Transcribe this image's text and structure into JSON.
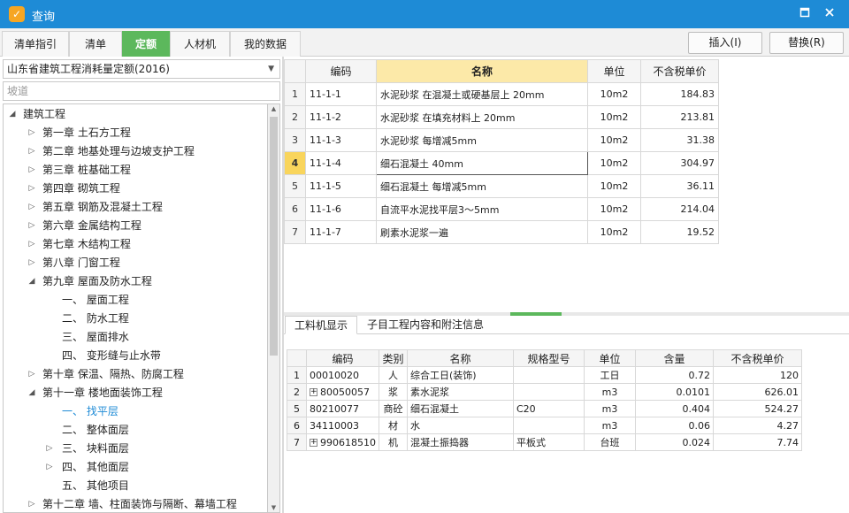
{
  "window": {
    "title": "查询",
    "maximize_icon": "maximize-icon",
    "close_icon": "close-icon"
  },
  "tabs": [
    "清单指引",
    "清单",
    "定额",
    "人材机",
    "我的数据"
  ],
  "active_tab": "定额",
  "toolbar": {
    "insert_label": "插入(I)",
    "replace_label": "替换(R)"
  },
  "left": {
    "library": "山东省建筑工程消耗量定额(2016)",
    "search_placeholder": "坡道",
    "tree": [
      {
        "label": "建筑工程",
        "level": 0,
        "state": "open"
      },
      {
        "label": "第一章  土石方工程",
        "level": 1,
        "state": "closed"
      },
      {
        "label": "第二章  地基处理与边坡支护工程",
        "level": 1,
        "state": "closed"
      },
      {
        "label": "第三章  桩基础工程",
        "level": 1,
        "state": "closed"
      },
      {
        "label": "第四章  砌筑工程",
        "level": 1,
        "state": "closed"
      },
      {
        "label": "第五章  钢筋及混凝土工程",
        "level": 1,
        "state": "closed"
      },
      {
        "label": "第六章  金属结构工程",
        "level": 1,
        "state": "closed"
      },
      {
        "label": "第七章  木结构工程",
        "level": 1,
        "state": "closed"
      },
      {
        "label": "第八章  门窗工程",
        "level": 1,
        "state": "closed"
      },
      {
        "label": "第九章  屋面及防水工程",
        "level": 1,
        "state": "open"
      },
      {
        "label": "一、  屋面工程",
        "level": 2,
        "state": "none"
      },
      {
        "label": "二、  防水工程",
        "level": 2,
        "state": "none"
      },
      {
        "label": "三、  屋面排水",
        "level": 2,
        "state": "none"
      },
      {
        "label": "四、  变形缝与止水带",
        "level": 2,
        "state": "none"
      },
      {
        "label": "第十章  保温、隔热、防腐工程",
        "level": 1,
        "state": "closed"
      },
      {
        "label": "第十一章  楼地面装饰工程",
        "level": 1,
        "state": "open"
      },
      {
        "label": "一、  找平层",
        "level": 2,
        "state": "none",
        "selected": true
      },
      {
        "label": "二、  整体面层",
        "level": 2,
        "state": "none"
      },
      {
        "label": "三、  块料面层",
        "level": 2,
        "state": "closed"
      },
      {
        "label": "四、  其他面层",
        "level": 2,
        "state": "closed"
      },
      {
        "label": "五、  其他项目",
        "level": 2,
        "state": "none"
      },
      {
        "label": "第十二章  墙、柱面装饰与隔断、幕墙工程",
        "level": 1,
        "state": "closed"
      }
    ]
  },
  "main": {
    "columns": [
      "编码",
      "名称",
      "单位",
      "不含税单价"
    ],
    "current_row": 4,
    "rows": [
      {
        "n": "1",
        "code": "11-1-1",
        "name": "水泥砂浆 在混凝土或硬基层上 20mm",
        "unit": "10m2",
        "price": "184.83"
      },
      {
        "n": "2",
        "code": "11-1-2",
        "name": "水泥砂浆 在填充材料上 20mm",
        "unit": "10m2",
        "price": "213.81"
      },
      {
        "n": "3",
        "code": "11-1-3",
        "name": "水泥砂浆 每增减5mm",
        "unit": "10m2",
        "price": "31.38"
      },
      {
        "n": "4",
        "code": "11-1-4",
        "name": "细石混凝土 40mm",
        "unit": "10m2",
        "price": "304.97"
      },
      {
        "n": "5",
        "code": "11-1-5",
        "name": "细石混凝土 每增减5mm",
        "unit": "10m2",
        "price": "36.11"
      },
      {
        "n": "6",
        "code": "11-1-6",
        "name": "自流平水泥找平层3～5mm",
        "unit": "10m2",
        "price": "214.04"
      },
      {
        "n": "7",
        "code": "11-1-7",
        "name": "刷素水泥浆一遍",
        "unit": "10m2",
        "price": "19.52"
      }
    ]
  },
  "bottom": {
    "tabs": [
      "工料机显示",
      "子目工程内容和附注信息"
    ],
    "columns": [
      "编码",
      "类别",
      "名称",
      "规格型号",
      "单位",
      "含量",
      "不含税单价"
    ],
    "rows": [
      {
        "n": "1",
        "expand": false,
        "code": "00010020",
        "cat": "人",
        "name": "综合工日(装饰)",
        "spec": "",
        "unit": "工日",
        "qty": "0.72",
        "price": "120"
      },
      {
        "n": "2",
        "expand": true,
        "code": "80050057",
        "cat": "浆",
        "name": "素水泥浆",
        "spec": "",
        "unit": "m3",
        "qty": "0.0101",
        "price": "626.01"
      },
      {
        "n": "5",
        "expand": false,
        "code": "80210077",
        "cat": "商砼",
        "name": "细石混凝土",
        "spec": "C20",
        "unit": "m3",
        "qty": "0.404",
        "price": "524.27"
      },
      {
        "n": "6",
        "expand": false,
        "code": "34110003",
        "cat": "材",
        "name": "水",
        "spec": "",
        "unit": "m3",
        "qty": "0.06",
        "price": "4.27"
      },
      {
        "n": "7",
        "expand": true,
        "code": "990618510",
        "cat": "机",
        "name": "混凝土振捣器",
        "spec": "平板式",
        "unit": "台班",
        "qty": "0.024",
        "price": "7.74"
      }
    ]
  }
}
